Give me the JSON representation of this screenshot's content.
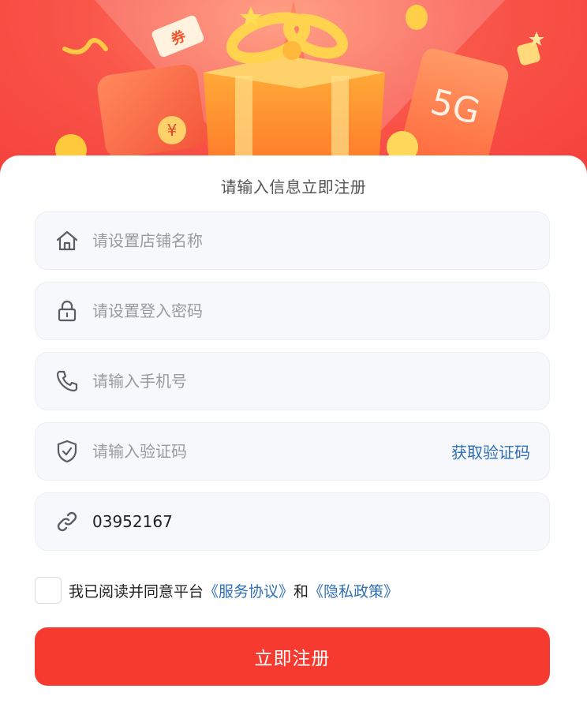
{
  "colors": {
    "banner": "#f9564a",
    "accent": "#f63a30",
    "link": "#2e6fb5",
    "field_bg": "#f7f8fb"
  },
  "banner": {
    "badge_text": "5G",
    "coupon_text": "券",
    "red_envelope_symbol": "¥"
  },
  "form": {
    "title": "请输入信息立即注册",
    "fields": [
      {
        "icon": "home-icon",
        "placeholder": "请设置店铺名称",
        "value": ""
      },
      {
        "icon": "lock-icon",
        "placeholder": "请设置登入密码",
        "value": ""
      },
      {
        "icon": "phone-icon",
        "placeholder": "请输入手机号",
        "value": ""
      },
      {
        "icon": "shield-check-icon",
        "placeholder": "请输入验证码",
        "value": ""
      },
      {
        "icon": "link-icon",
        "placeholder": "",
        "value": "03952167"
      }
    ],
    "get_code_label": "获取验证码",
    "agreement": {
      "prefix": "我已阅读并同意平台",
      "service_link": "《服务协议》",
      "and": "和",
      "privacy_link": "《隐私政策》",
      "checked": false
    },
    "submit_label": "立即注册"
  }
}
